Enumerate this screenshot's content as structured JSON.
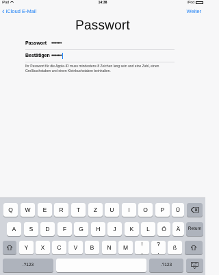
{
  "status_bar": {
    "device": "iPad",
    "time": "14:38",
    "right_label": "iPod"
  },
  "nav": {
    "back_label": "iCloud E-Mail",
    "next_label": "Weiter"
  },
  "page_title": "Passwort",
  "form": {
    "password_label": "Passwort",
    "password_value": "••••••••",
    "confirm_label": "Bestätigen",
    "confirm_value": "••••••••"
  },
  "hint": "Ihr Passwort für die Apple-ID muss mindestens 8 Zeichen lang sein und eine Zahl, einen Großbuchstaben und einen Kleinbuchstaben beinhalten.",
  "keyboard": {
    "row1": [
      "Q",
      "W",
      "E",
      "R",
      "T",
      "Z",
      "U",
      "I",
      "O",
      "P",
      "Ü"
    ],
    "row2": [
      "A",
      "S",
      "D",
      "F",
      "G",
      "H",
      "J",
      "K",
      "L",
      "Ö",
      "Ä"
    ],
    "row3": [
      "Y",
      "X",
      "C",
      "V",
      "B",
      "N",
      "M",
      "!",
      "?",
      "ß"
    ],
    "row3_punct_secondary": [
      ",",
      "."
    ],
    "return_label": "Return",
    "numbers_label": ".?123",
    "shift_icon": "shift-arrow-icon",
    "delete_icon": "backspace-icon",
    "hide_icon": "keyboard-hide-icon"
  }
}
